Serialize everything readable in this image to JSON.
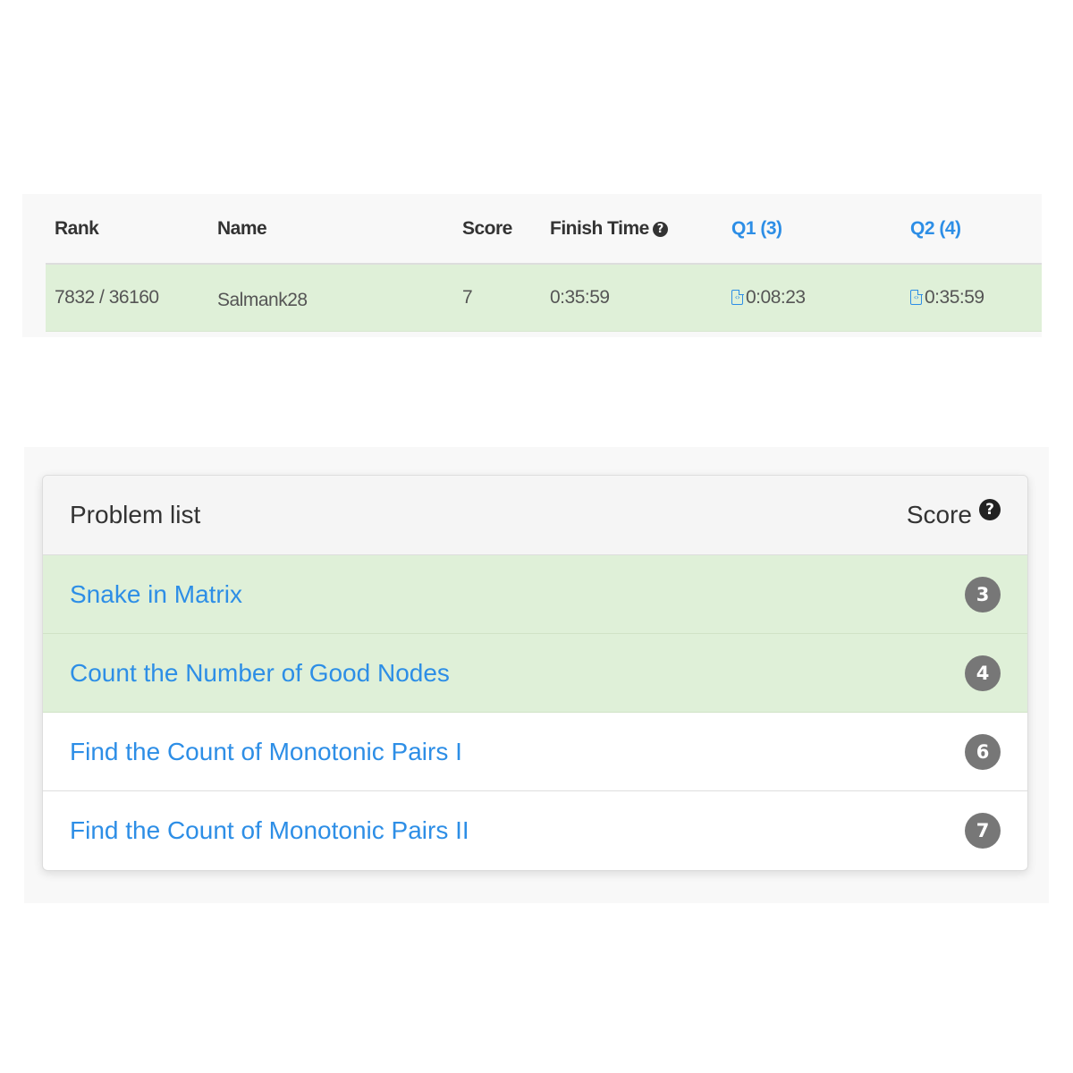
{
  "ranking": {
    "headers": {
      "rank": "Rank",
      "name": "Name",
      "score": "Score",
      "finish_time": "Finish Time",
      "q1": "Q1 (3)",
      "q2": "Q2 (4)"
    },
    "row": {
      "rank": "7832 / 36160",
      "name": "Salmank28",
      "score": "7",
      "finish_time": "0:35:59",
      "q1_time": "0:08:23",
      "q2_time": "0:35:59"
    }
  },
  "problem_list": {
    "title": "Problem list",
    "score_label": "Score",
    "problems": [
      {
        "title": "Snake in Matrix",
        "score": "3",
        "solved": true
      },
      {
        "title": "Count the Number of Good Nodes",
        "score": "4",
        "solved": true
      },
      {
        "title": "Find the Count of Monotonic Pairs I",
        "score": "6",
        "solved": false
      },
      {
        "title": "Find the Count of Monotonic Pairs II",
        "score": "7",
        "solved": false
      }
    ]
  },
  "icons": {
    "help": "question-circle-icon",
    "code_file": "code-file-icon"
  },
  "colors": {
    "link": "#2d8ee6",
    "solved_row": "#dff0d8",
    "badge": "#777777"
  }
}
